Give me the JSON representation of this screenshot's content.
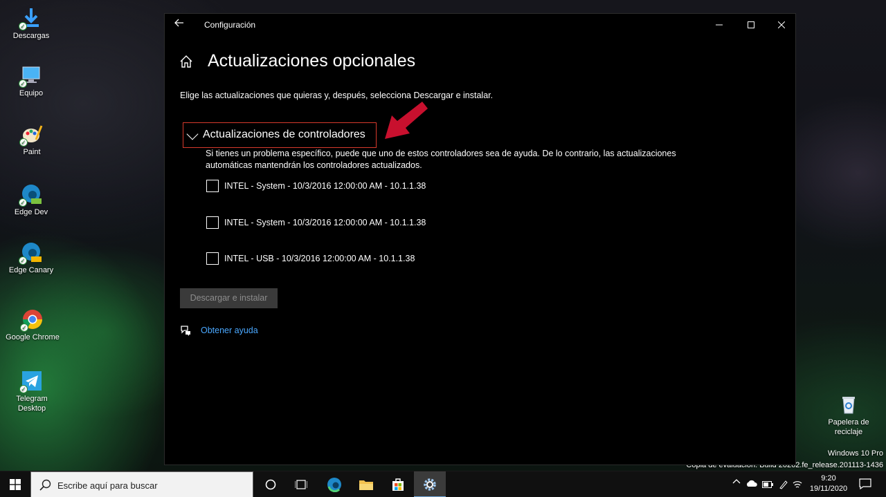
{
  "desktop": {
    "icons": [
      {
        "label": "Descargas"
      },
      {
        "label": "Equipo"
      },
      {
        "label": "Paint"
      },
      {
        "label": "Edge Dev",
        "badge": "DEV"
      },
      {
        "label": "Edge Canary",
        "badge": "CAN"
      },
      {
        "label": "Google Chrome"
      },
      {
        "label": "Telegram Desktop"
      },
      {
        "label": "Papelera de reciclaje"
      }
    ],
    "watermark_edition": "Windows 10 Pro",
    "watermark_build": "Copia de evaluación. Build 20262.fe_release.201113-1436"
  },
  "window": {
    "title": "Configuración",
    "page_title": "Actualizaciones opcionales",
    "subtitle": "Elige las actualizaciones que quieras y, después, selecciona Descargar e instalar.",
    "section": {
      "header": "Actualizaciones de controladores",
      "description": "Si tienes un problema específico, puede que uno de estos controladores sea de ayuda. De lo contrario, las actualizaciones automáticas mantendrán los controladores actualizados.",
      "options": [
        {
          "label": "INTEL - System - 10/3/2016 12:00:00 AM - 10.1.1.38",
          "checked": false
        },
        {
          "label": "INTEL - System - 10/3/2016 12:00:00 AM - 10.1.1.38",
          "checked": false
        },
        {
          "label": "INTEL - USB - 10/3/2016 12:00:00 AM - 10.1.1.38",
          "checked": false
        }
      ]
    },
    "install_button": "Descargar e instalar",
    "help_link": "Obtener ayuda"
  },
  "taskbar": {
    "search_placeholder": "Escribe aquí para buscar",
    "clock_time": "9:20",
    "clock_date": "19/11/2020"
  },
  "colors": {
    "accent_link": "#4aa8ff",
    "highlight_border": "#d83a2c",
    "arrow": "#c8102e"
  }
}
